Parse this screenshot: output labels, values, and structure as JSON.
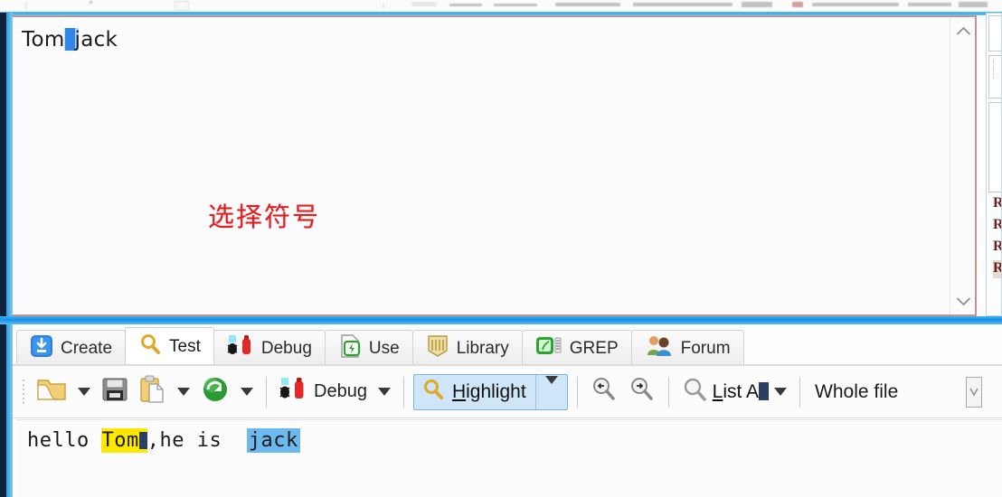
{
  "editor": {
    "text_before": "Tom",
    "selection_marker": "selected-symbol-block",
    "text_after": "jack",
    "annotation": "选择符号",
    "annotation_color": "#e02020",
    "scroll_up_icon": "chevron-up-icon",
    "scroll_down_icon": "chevron-down-icon"
  },
  "right_panel": {
    "items": [
      {
        "label": "R"
      },
      {
        "label": "R"
      },
      {
        "label": "R"
      },
      {
        "label": "R"
      }
    ]
  },
  "tabs": [
    {
      "label": "Create",
      "icon": "create-icon",
      "active": false
    },
    {
      "label": "Test",
      "icon": "search-icon",
      "active": true
    },
    {
      "label": "Debug",
      "icon": "debug-icon",
      "active": false
    },
    {
      "label": "Use",
      "icon": "use-icon",
      "active": false
    },
    {
      "label": "Library",
      "icon": "library-icon",
      "active": false
    },
    {
      "label": "GREP",
      "icon": "grep-icon",
      "active": false
    },
    {
      "label": "Forum",
      "icon": "forum-icon",
      "active": false
    }
  ],
  "toolbar": {
    "open_icon": "folder-open-icon",
    "save_icon": "floppy-save-icon",
    "paste_icon": "clipboard-paste-icon",
    "refresh_icon": "green-globe-refresh-icon",
    "debug_label": "Debug",
    "debug_icon": "debug-icon",
    "highlight_label": "Highlight",
    "highlight_accel": "H",
    "highlight_icon": "magnifier-icon",
    "highlight_active": true,
    "highlight_bg": "#cfe5f8",
    "find_prev_icon": "search-back-icon",
    "find_next_icon": "search-forward-icon",
    "list_all_label": "List All",
    "list_all_icon": "magnifier-icon",
    "scope_label": "Whole file",
    "overflow_icon": "toolbar-overflow-icon"
  },
  "output": {
    "prefix": "hello ",
    "match_yellow": "Tom",
    "middle": ",he is  ",
    "match_blue": "jack"
  },
  "colors": {
    "accent_blue": "#1a8ee8",
    "highlight_yellow": "#ffe800",
    "selection_blue": "#6eb8f0",
    "annotation_red": "#e02020",
    "editor_border": "#c3938c"
  }
}
